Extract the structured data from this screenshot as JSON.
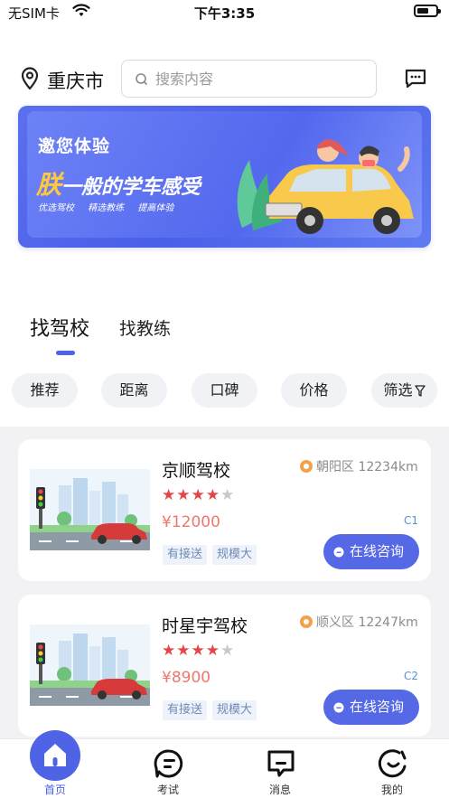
{
  "status_bar": {
    "carrier": "无SIM卡",
    "time": "下午3:35"
  },
  "header": {
    "city": "重庆市",
    "search_placeholder": "搜索内容"
  },
  "banner": {
    "line1": "邀您体验",
    "line2_highlight": "朕",
    "line2_rest": "一般的学车感受",
    "tags": [
      "优选驾校",
      "精选教练",
      "提高体验"
    ]
  },
  "tabs": [
    {
      "label": "找驾校",
      "active": true
    },
    {
      "label": "找教练",
      "active": false
    }
  ],
  "filters": [
    "推荐",
    "距离",
    "口碑",
    "价格",
    "筛选"
  ],
  "schools": [
    {
      "name": "京顺驾校",
      "rating": 4,
      "max_rating": 5,
      "price": "¥12000",
      "tags": [
        "有接送",
        "规模大"
      ],
      "location": "朝阳区 12234km",
      "license": "C1",
      "action_label": "在线咨询"
    },
    {
      "name": "时星宇驾校",
      "rating": 4,
      "max_rating": 5,
      "price": "¥8900",
      "tags": [
        "有接送",
        "规模大"
      ],
      "location": "顺义区 12247km",
      "license": "C2",
      "action_label": "在线咨询"
    }
  ],
  "tabbar": [
    {
      "label": "首页",
      "icon": "home-icon",
      "active": true
    },
    {
      "label": "考试",
      "icon": "exam-icon",
      "active": false
    },
    {
      "label": "消息",
      "icon": "message-icon",
      "active": false
    },
    {
      "label": "我的",
      "icon": "profile-icon",
      "active": false
    }
  ],
  "colors": {
    "accent": "#4e63e6",
    "price": "#f0766f",
    "star": "#e64545",
    "tab_bg": "#f0f2f6"
  }
}
